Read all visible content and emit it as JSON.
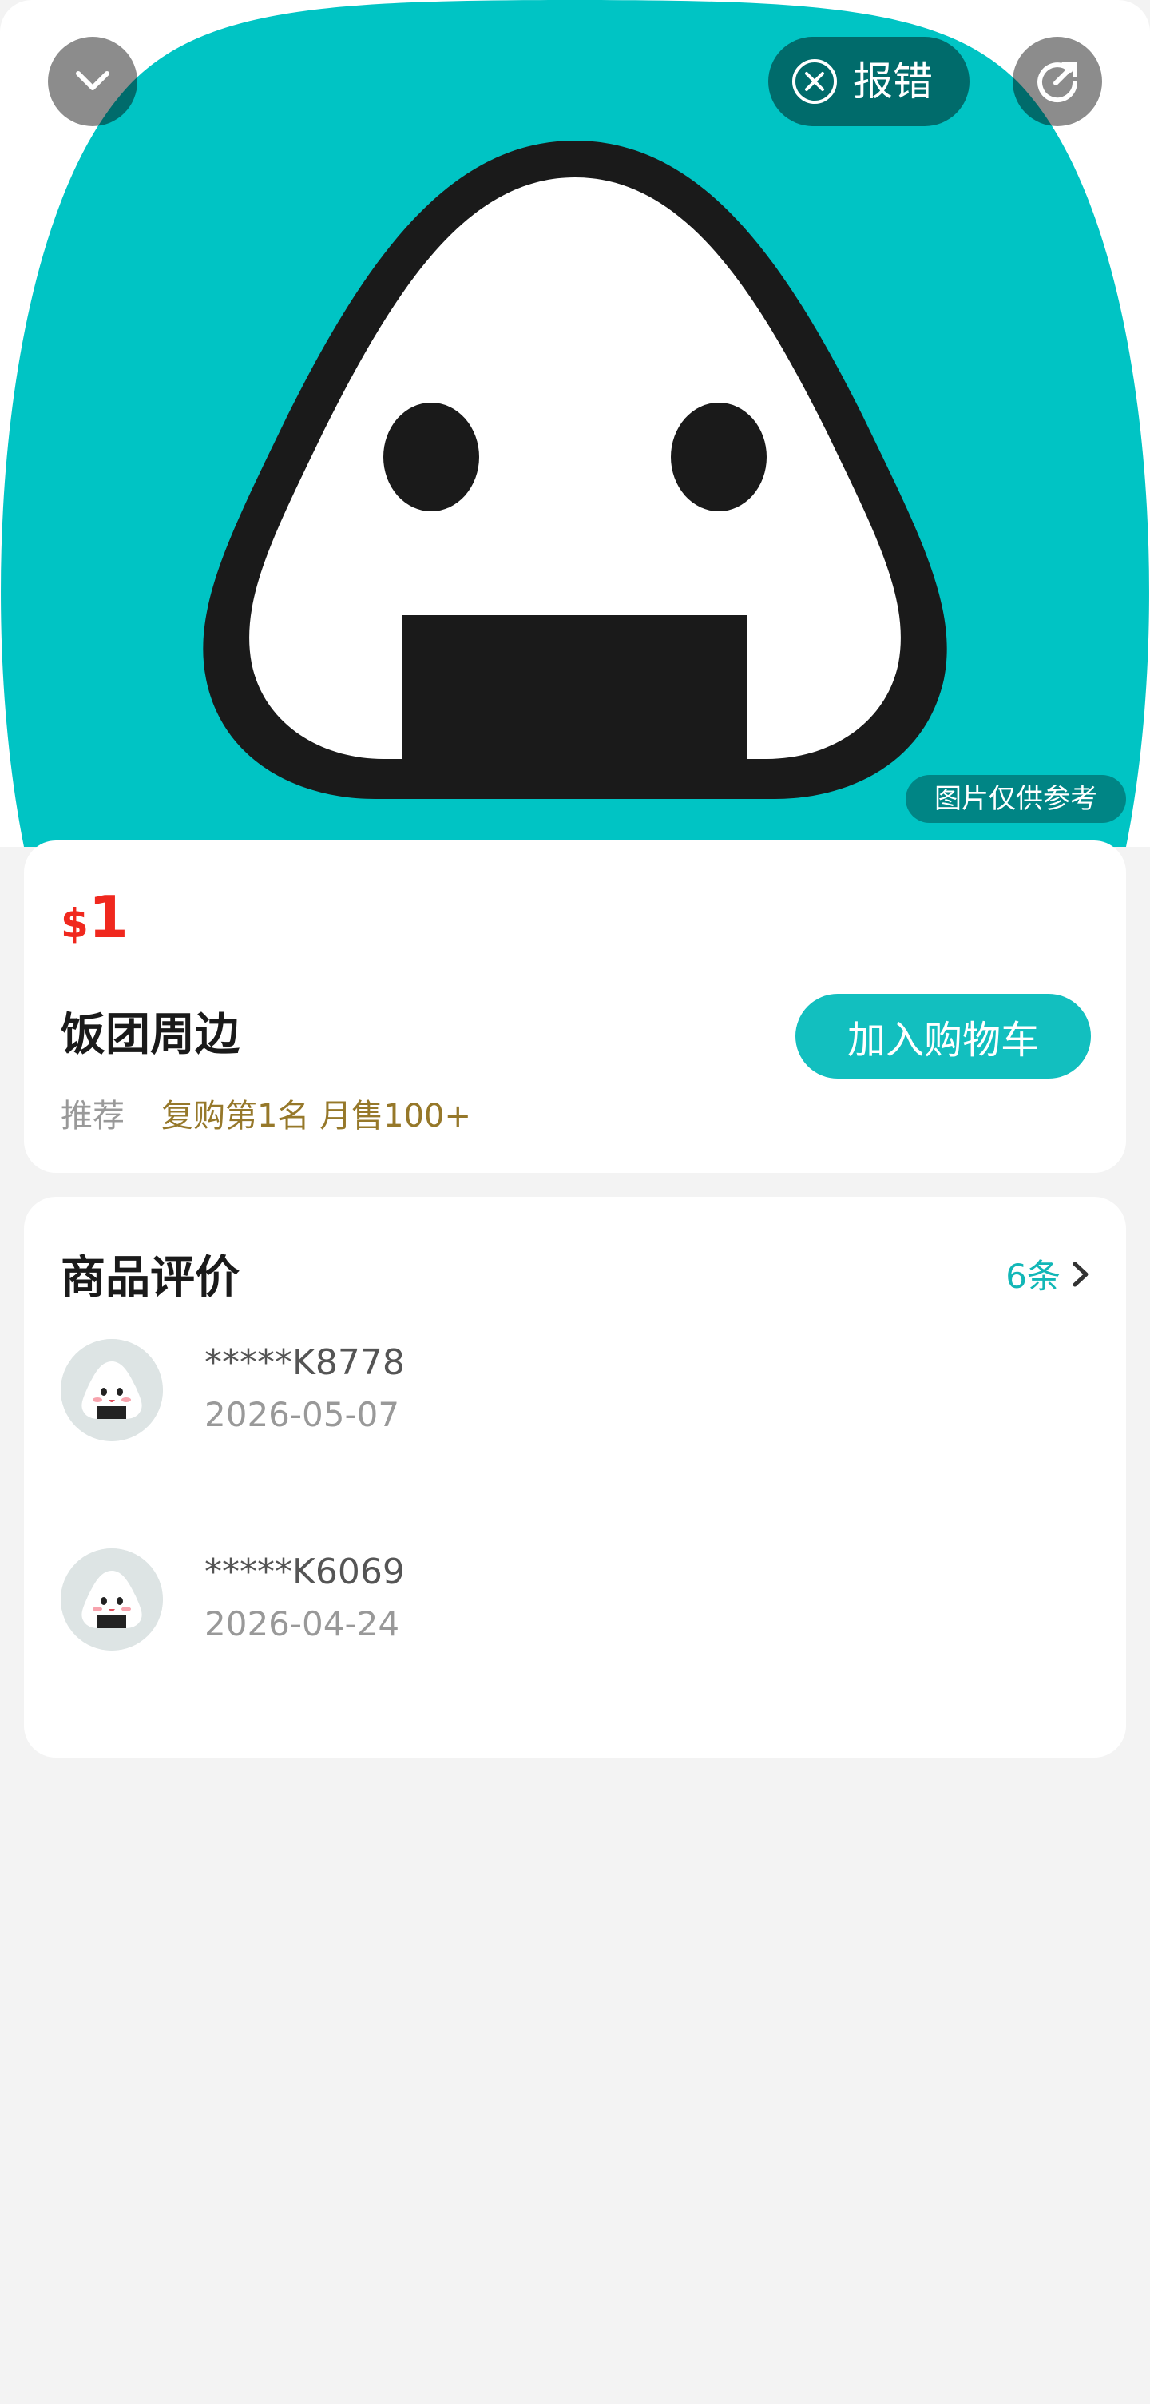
{
  "header": {
    "report_label": "报错",
    "image_note": "图片仅供参考",
    "icons": {
      "collapse": "chevron-down-icon",
      "report": "close-circle-icon",
      "share": "share-icon"
    }
  },
  "product": {
    "currency": "$",
    "price": "1",
    "name": "饭团周边",
    "tag": "推荐",
    "stats": "复购第1名 月售100+",
    "add_to_cart": "加入购物车"
  },
  "reviews": {
    "title": "商品评价",
    "count": "6条",
    "items": [
      {
        "user": "*****K8778",
        "date": "2026-05-07"
      },
      {
        "user": "*****K6069",
        "date": "2026-04-24"
      }
    ]
  },
  "colors": {
    "accent": "#12bfbf",
    "hero_bg": "#00c4c4",
    "price": "#f0281e",
    "stats": "#96782a"
  }
}
